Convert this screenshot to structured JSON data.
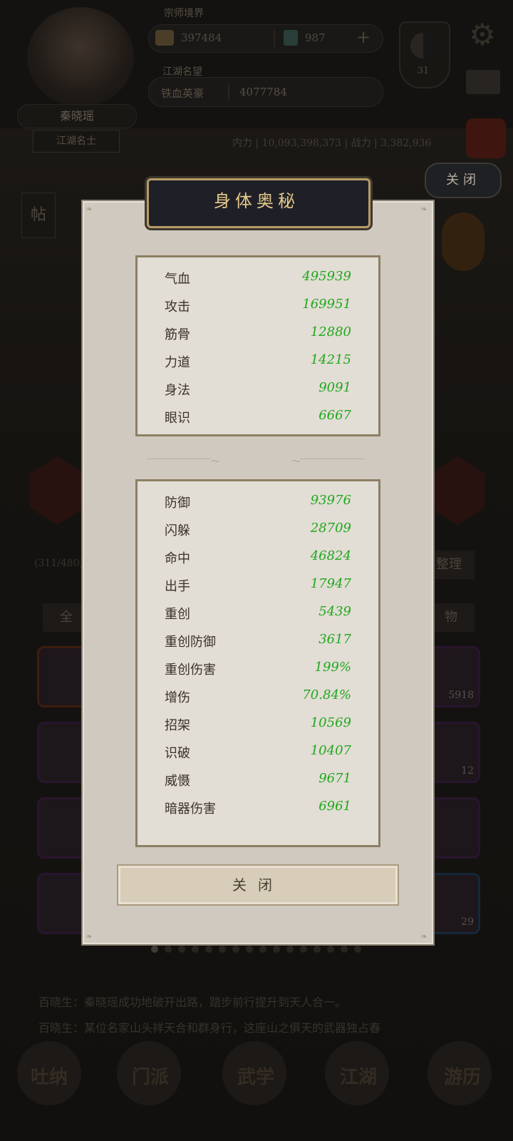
{
  "header": {
    "level_label": "宗师境界",
    "player_name": "秦晓瑶",
    "player_title": "江湖名士",
    "gold": "397484",
    "jade": "987",
    "fame_label": "江湖名望",
    "fame_rank": "铁血英豪",
    "fame_value": "4077784",
    "taiji_value": "31",
    "power_text": "内力 | 10,093,398,373 | 战力 | 3,382,936",
    "back_close_label": "关闭",
    "note_label": "帖"
  },
  "sidebar": {
    "count_label": "(311/480)",
    "sort_label": "整理",
    "tab_all": "全",
    "tab_item": "物",
    "item_counts": [
      "5918",
      "12",
      "",
      "29"
    ]
  },
  "news": {
    "line1": "百晓生：秦晓瑶成功地破开出路，踏步前行提升到天人合一。",
    "line2": "百晓生：某位名家山头祥天合和群身行，这座山之俱天的武器独占春"
  },
  "nav": [
    "吐纳",
    "门派",
    "武学",
    "江湖",
    "游历"
  ],
  "dialog": {
    "title": "身体奥秘",
    "close_label": "关闭",
    "primary_stats": [
      {
        "label": "气血",
        "value": "495939"
      },
      {
        "label": "攻击",
        "value": "169951"
      },
      {
        "label": "筋骨",
        "value": "12880"
      },
      {
        "label": "力道",
        "value": "14215"
      },
      {
        "label": "身法",
        "value": "9091"
      },
      {
        "label": "眼识",
        "value": "6667"
      }
    ],
    "secondary_stats": [
      {
        "label": "防御",
        "value": "93976"
      },
      {
        "label": "闪躲",
        "value": "28709"
      },
      {
        "label": "命中",
        "value": "46824"
      },
      {
        "label": "出手",
        "value": "17947"
      },
      {
        "label": "重创",
        "value": "5439"
      },
      {
        "label": "重创防御",
        "value": "3617"
      },
      {
        "label": "重创伤害",
        "value": "199%"
      },
      {
        "label": "增伤",
        "value": "70.84%"
      },
      {
        "label": "招架",
        "value": "10569"
      },
      {
        "label": "识破",
        "value": "10407"
      },
      {
        "label": "威慑",
        "value": "9671"
      },
      {
        "label": "暗器伤害",
        "value": "6961"
      }
    ]
  }
}
